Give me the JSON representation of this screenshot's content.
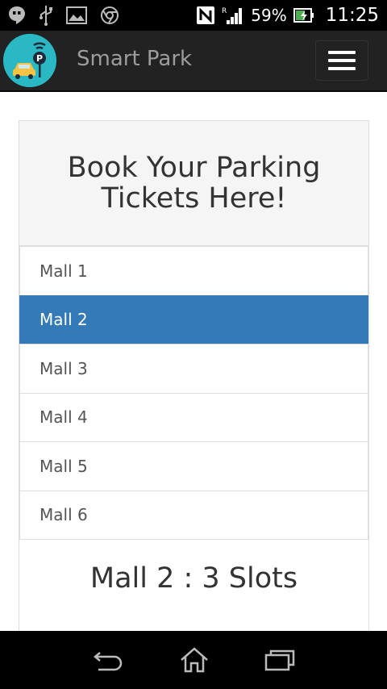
{
  "status_bar": {
    "battery_percent": "59%",
    "time": "11:25",
    "signal_roaming": "R"
  },
  "navbar": {
    "brand": "Smart Park",
    "logo_icon": "parking-car-icon",
    "menu_icon": "hamburger-menu-icon"
  },
  "panel": {
    "title": "Book Your Parking Tickets Here!",
    "malls": [
      {
        "label": "Mall 1",
        "active": false
      },
      {
        "label": "Mall 2",
        "active": true
      },
      {
        "label": "Mall 3",
        "active": false
      },
      {
        "label": "Mall 4",
        "active": false
      },
      {
        "label": "Mall 5",
        "active": false
      },
      {
        "label": "Mall 6",
        "active": false
      }
    ],
    "slots_text": "Mall 2 : 3 Slots"
  },
  "colors": {
    "navbar_bg": "#222222",
    "active_item": "#337ab7",
    "logo_bg": "#2ab8c4"
  }
}
